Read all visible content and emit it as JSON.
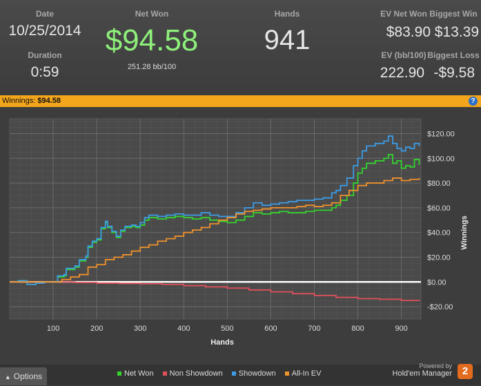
{
  "stats": {
    "date_label": "Date",
    "date_value": "10/25/2014",
    "duration_label": "Duration",
    "duration_value": "0:59",
    "net_won_label": "Net Won",
    "net_won_value": "$94.58",
    "bb_per_100": "251.28 bb/100",
    "hands_label": "Hands",
    "hands_value": "941",
    "ev_net_won_label": "EV Net Won",
    "ev_net_won_value": "$83.90",
    "biggest_win_label": "Biggest Win",
    "biggest_win_value": "$13.39",
    "ev_bb_label": "EV (bb/100)",
    "ev_bb_value": "222.90",
    "biggest_loss_label": "Biggest Loss",
    "biggest_loss_value": "-$9.58"
  },
  "banner": {
    "label": "Winnings:",
    "value": "$94.58",
    "help_icon": "?"
  },
  "footer": {
    "options_label": "Options",
    "powered_by": "Powered by",
    "brand": "Hold'em Manager",
    "brand_logo": "2"
  },
  "colors": {
    "net_won": "#34d42e",
    "non_showdown": "#e0505a",
    "showdown": "#3c9ce6",
    "all_in_ev": "#f0922c",
    "net_won_text": "#8ef07a",
    "banner": "#f3a51b"
  },
  "chart_data": {
    "type": "line",
    "xlabel": "Hands",
    "ylabel": "Winnings",
    "xlim": [
      0,
      945
    ],
    "ylim": [
      -30,
      132
    ],
    "x_ticks": [
      100,
      200,
      300,
      400,
      500,
      600,
      700,
      800,
      900
    ],
    "y_ticks": [
      -20,
      0,
      20,
      40,
      60,
      80,
      100,
      120
    ],
    "y_tick_labels": [
      "-$20.00",
      "$0.00",
      "$20.00",
      "$40.00",
      "$60.00",
      "$80.00",
      "$100.00",
      "$120.00"
    ],
    "legend_position": "bottom",
    "series": [
      {
        "name": "Net Won",
        "color": "#34d42e",
        "points": [
          [
            0,
            0
          ],
          [
            20,
            1
          ],
          [
            40,
            -2
          ],
          [
            60,
            -1
          ],
          [
            80,
            0
          ],
          [
            100,
            0
          ],
          [
            110,
            4
          ],
          [
            125,
            5
          ],
          [
            130,
            10
          ],
          [
            150,
            12
          ],
          [
            160,
            17
          ],
          [
            175,
            20
          ],
          [
            180,
            28
          ],
          [
            190,
            32
          ],
          [
            200,
            34
          ],
          [
            210,
            43
          ],
          [
            220,
            48
          ],
          [
            225,
            44
          ],
          [
            235,
            40
          ],
          [
            245,
            36
          ],
          [
            255,
            41
          ],
          [
            265,
            44
          ],
          [
            280,
            45
          ],
          [
            290,
            44
          ],
          [
            300,
            46
          ],
          [
            310,
            50
          ],
          [
            320,
            52
          ],
          [
            340,
            51
          ],
          [
            360,
            52
          ],
          [
            380,
            53
          ],
          [
            400,
            52
          ],
          [
            420,
            51
          ],
          [
            440,
            52
          ],
          [
            460,
            50
          ],
          [
            480,
            49
          ],
          [
            500,
            48
          ],
          [
            520,
            50
          ],
          [
            540,
            53
          ],
          [
            560,
            56
          ],
          [
            580,
            55
          ],
          [
            600,
            56
          ],
          [
            620,
            57
          ],
          [
            640,
            56
          ],
          [
            660,
            56
          ],
          [
            680,
            57
          ],
          [
            700,
            58
          ],
          [
            720,
            58
          ],
          [
            740,
            60
          ],
          [
            750,
            62
          ],
          [
            760,
            66
          ],
          [
            775,
            70
          ],
          [
            790,
            80
          ],
          [
            800,
            88
          ],
          [
            810,
            92
          ],
          [
            820,
            96
          ],
          [
            840,
            98
          ],
          [
            860,
            100
          ],
          [
            870,
            103
          ],
          [
            880,
            96
          ],
          [
            890,
            98
          ],
          [
            900,
            92
          ],
          [
            910,
            94
          ],
          [
            920,
            93
          ],
          [
            930,
            99
          ],
          [
            941,
            94.58
          ]
        ]
      },
      {
        "name": "Non Showdown",
        "color": "#e0505a",
        "points": [
          [
            0,
            0
          ],
          [
            100,
            0
          ],
          [
            150,
            -0.5
          ],
          [
            200,
            -1
          ],
          [
            250,
            -1.2
          ],
          [
            300,
            -1.5
          ],
          [
            350,
            -2
          ],
          [
            400,
            -3
          ],
          [
            450,
            -4
          ],
          [
            500,
            -5
          ],
          [
            550,
            -6.5
          ],
          [
            600,
            -8
          ],
          [
            650,
            -9.5
          ],
          [
            700,
            -11
          ],
          [
            750,
            -12.5
          ],
          [
            800,
            -13.5
          ],
          [
            850,
            -14
          ],
          [
            900,
            -15
          ],
          [
            941,
            -15.5
          ]
        ]
      },
      {
        "name": "Showdown",
        "color": "#3c9ce6",
        "points": [
          [
            0,
            0
          ],
          [
            20,
            1
          ],
          [
            40,
            -2
          ],
          [
            60,
            -1
          ],
          [
            80,
            0
          ],
          [
            100,
            0
          ],
          [
            110,
            5
          ],
          [
            125,
            6
          ],
          [
            130,
            11
          ],
          [
            150,
            13
          ],
          [
            160,
            18
          ],
          [
            175,
            21
          ],
          [
            180,
            29
          ],
          [
            190,
            33
          ],
          [
            200,
            35
          ],
          [
            210,
            44
          ],
          [
            220,
            49
          ],
          [
            225,
            45
          ],
          [
            235,
            41
          ],
          [
            245,
            37
          ],
          [
            255,
            42
          ],
          [
            265,
            45
          ],
          [
            280,
            46
          ],
          [
            290,
            45
          ],
          [
            300,
            48
          ],
          [
            310,
            52
          ],
          [
            320,
            54
          ],
          [
            340,
            53
          ],
          [
            360,
            54
          ],
          [
            380,
            55
          ],
          [
            400,
            54
          ],
          [
            420,
            54
          ],
          [
            440,
            56
          ],
          [
            460,
            54
          ],
          [
            480,
            53
          ],
          [
            500,
            53
          ],
          [
            520,
            56
          ],
          [
            540,
            60
          ],
          [
            560,
            64
          ],
          [
            580,
            62
          ],
          [
            600,
            63
          ],
          [
            620,
            64
          ],
          [
            640,
            65
          ],
          [
            660,
            66
          ],
          [
            680,
            66
          ],
          [
            700,
            67
          ],
          [
            720,
            68
          ],
          [
            740,
            72
          ],
          [
            750,
            74
          ],
          [
            760,
            78
          ],
          [
            775,
            84
          ],
          [
            790,
            94
          ],
          [
            800,
            100
          ],
          [
            810,
            106
          ],
          [
            820,
            110
          ],
          [
            840,
            112
          ],
          [
            860,
            114
          ],
          [
            870,
            118
          ],
          [
            880,
            112
          ],
          [
            890,
            108
          ],
          [
            900,
            106
          ],
          [
            910,
            109
          ],
          [
            920,
            108
          ],
          [
            930,
            112
          ],
          [
            941,
            110
          ]
        ]
      },
      {
        "name": "All-In EV",
        "color": "#f0922c",
        "points": [
          [
            0,
            0
          ],
          [
            100,
            0
          ],
          [
            120,
            2
          ],
          [
            140,
            4
          ],
          [
            160,
            6
          ],
          [
            180,
            12
          ],
          [
            200,
            14
          ],
          [
            220,
            18
          ],
          [
            240,
            20
          ],
          [
            260,
            22
          ],
          [
            280,
            25
          ],
          [
            300,
            28
          ],
          [
            320,
            30
          ],
          [
            340,
            33
          ],
          [
            360,
            35
          ],
          [
            380,
            37
          ],
          [
            400,
            40
          ],
          [
            420,
            42
          ],
          [
            440,
            44
          ],
          [
            460,
            47
          ],
          [
            480,
            50
          ],
          [
            500,
            52
          ],
          [
            520,
            55
          ],
          [
            540,
            57
          ],
          [
            560,
            58
          ],
          [
            580,
            59
          ],
          [
            600,
            60
          ],
          [
            620,
            60
          ],
          [
            640,
            60
          ],
          [
            660,
            61
          ],
          [
            680,
            62
          ],
          [
            700,
            61
          ],
          [
            720,
            62
          ],
          [
            740,
            64
          ],
          [
            760,
            70
          ],
          [
            780,
            74
          ],
          [
            800,
            78
          ],
          [
            820,
            80
          ],
          [
            840,
            80
          ],
          [
            860,
            82
          ],
          [
            880,
            84
          ],
          [
            900,
            82
          ],
          [
            920,
            83
          ],
          [
            941,
            84
          ]
        ]
      }
    ]
  }
}
